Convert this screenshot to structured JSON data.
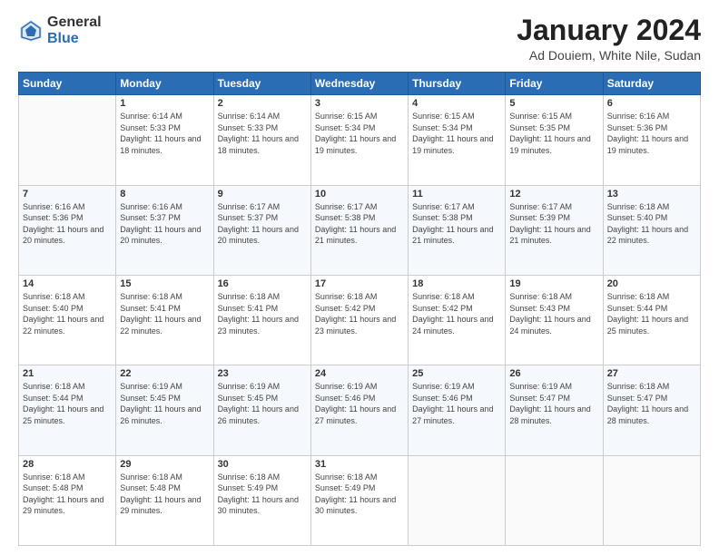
{
  "header": {
    "logo_general": "General",
    "logo_blue": "Blue",
    "main_title": "January 2024",
    "subtitle": "Ad Douiem, White Nile, Sudan"
  },
  "calendar": {
    "days_of_week": [
      "Sunday",
      "Monday",
      "Tuesday",
      "Wednesday",
      "Thursday",
      "Friday",
      "Saturday"
    ],
    "weeks": [
      [
        {
          "day": "",
          "info": ""
        },
        {
          "day": "1",
          "info": "Sunrise: 6:14 AM\nSunset: 5:33 PM\nDaylight: 11 hours\nand 18 minutes."
        },
        {
          "day": "2",
          "info": "Sunrise: 6:14 AM\nSunset: 5:33 PM\nDaylight: 11 hours\nand 18 minutes."
        },
        {
          "day": "3",
          "info": "Sunrise: 6:15 AM\nSunset: 5:34 PM\nDaylight: 11 hours\nand 19 minutes."
        },
        {
          "day": "4",
          "info": "Sunrise: 6:15 AM\nSunset: 5:34 PM\nDaylight: 11 hours\nand 19 minutes."
        },
        {
          "day": "5",
          "info": "Sunrise: 6:15 AM\nSunset: 5:35 PM\nDaylight: 11 hours\nand 19 minutes."
        },
        {
          "day": "6",
          "info": "Sunrise: 6:16 AM\nSunset: 5:36 PM\nDaylight: 11 hours\nand 19 minutes."
        }
      ],
      [
        {
          "day": "7",
          "info": "Sunrise: 6:16 AM\nSunset: 5:36 PM\nDaylight: 11 hours\nand 20 minutes."
        },
        {
          "day": "8",
          "info": "Sunrise: 6:16 AM\nSunset: 5:37 PM\nDaylight: 11 hours\nand 20 minutes."
        },
        {
          "day": "9",
          "info": "Sunrise: 6:17 AM\nSunset: 5:37 PM\nDaylight: 11 hours\nand 20 minutes."
        },
        {
          "day": "10",
          "info": "Sunrise: 6:17 AM\nSunset: 5:38 PM\nDaylight: 11 hours\nand 21 minutes."
        },
        {
          "day": "11",
          "info": "Sunrise: 6:17 AM\nSunset: 5:38 PM\nDaylight: 11 hours\nand 21 minutes."
        },
        {
          "day": "12",
          "info": "Sunrise: 6:17 AM\nSunset: 5:39 PM\nDaylight: 11 hours\nand 21 minutes."
        },
        {
          "day": "13",
          "info": "Sunrise: 6:18 AM\nSunset: 5:40 PM\nDaylight: 11 hours\nand 22 minutes."
        }
      ],
      [
        {
          "day": "14",
          "info": "Sunrise: 6:18 AM\nSunset: 5:40 PM\nDaylight: 11 hours\nand 22 minutes."
        },
        {
          "day": "15",
          "info": "Sunrise: 6:18 AM\nSunset: 5:41 PM\nDaylight: 11 hours\nand 22 minutes."
        },
        {
          "day": "16",
          "info": "Sunrise: 6:18 AM\nSunset: 5:41 PM\nDaylight: 11 hours\nand 23 minutes."
        },
        {
          "day": "17",
          "info": "Sunrise: 6:18 AM\nSunset: 5:42 PM\nDaylight: 11 hours\nand 23 minutes."
        },
        {
          "day": "18",
          "info": "Sunrise: 6:18 AM\nSunset: 5:42 PM\nDaylight: 11 hours\nand 24 minutes."
        },
        {
          "day": "19",
          "info": "Sunrise: 6:18 AM\nSunset: 5:43 PM\nDaylight: 11 hours\nand 24 minutes."
        },
        {
          "day": "20",
          "info": "Sunrise: 6:18 AM\nSunset: 5:44 PM\nDaylight: 11 hours\nand 25 minutes."
        }
      ],
      [
        {
          "day": "21",
          "info": "Sunrise: 6:18 AM\nSunset: 5:44 PM\nDaylight: 11 hours\nand 25 minutes."
        },
        {
          "day": "22",
          "info": "Sunrise: 6:19 AM\nSunset: 5:45 PM\nDaylight: 11 hours\nand 26 minutes."
        },
        {
          "day": "23",
          "info": "Sunrise: 6:19 AM\nSunset: 5:45 PM\nDaylight: 11 hours\nand 26 minutes."
        },
        {
          "day": "24",
          "info": "Sunrise: 6:19 AM\nSunset: 5:46 PM\nDaylight: 11 hours\nand 27 minutes."
        },
        {
          "day": "25",
          "info": "Sunrise: 6:19 AM\nSunset: 5:46 PM\nDaylight: 11 hours\nand 27 minutes."
        },
        {
          "day": "26",
          "info": "Sunrise: 6:19 AM\nSunset: 5:47 PM\nDaylight: 11 hours\nand 28 minutes."
        },
        {
          "day": "27",
          "info": "Sunrise: 6:18 AM\nSunset: 5:47 PM\nDaylight: 11 hours\nand 28 minutes."
        }
      ],
      [
        {
          "day": "28",
          "info": "Sunrise: 6:18 AM\nSunset: 5:48 PM\nDaylight: 11 hours\nand 29 minutes."
        },
        {
          "day": "29",
          "info": "Sunrise: 6:18 AM\nSunset: 5:48 PM\nDaylight: 11 hours\nand 29 minutes."
        },
        {
          "day": "30",
          "info": "Sunrise: 6:18 AM\nSunset: 5:49 PM\nDaylight: 11 hours\nand 30 minutes."
        },
        {
          "day": "31",
          "info": "Sunrise: 6:18 AM\nSunset: 5:49 PM\nDaylight: 11 hours\nand 30 minutes."
        },
        {
          "day": "",
          "info": ""
        },
        {
          "day": "",
          "info": ""
        },
        {
          "day": "",
          "info": ""
        }
      ]
    ]
  }
}
